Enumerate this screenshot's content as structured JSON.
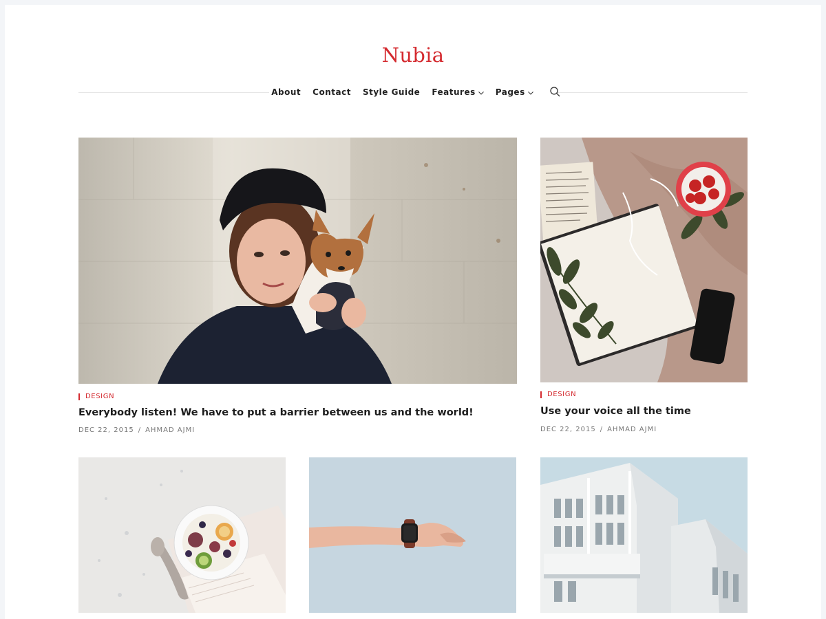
{
  "site": {
    "title": "Nubia"
  },
  "nav": {
    "items": [
      {
        "label": "About",
        "dropdown": false
      },
      {
        "label": "Contact",
        "dropdown": false
      },
      {
        "label": "Style Guide",
        "dropdown": false
      },
      {
        "label": "Features",
        "dropdown": true
      },
      {
        "label": "Pages",
        "dropdown": true
      }
    ],
    "search_icon": "search-icon"
  },
  "posts": [
    {
      "category": "DESIGN",
      "title": "Everybody listen! We have to put a barrier between us and the world!",
      "date": "DEC 22, 2015",
      "author": "AHMAD AJMI",
      "image": "woman-with-dog"
    },
    {
      "category": "DESIGN",
      "title": "Use your voice all the time",
      "date": "DEC 22, 2015",
      "author": "AHMAD AJMI",
      "image": "notebook-strawberries"
    },
    {
      "image": "fruit-bowl"
    },
    {
      "image": "wrist-watch"
    },
    {
      "image": "white-building"
    }
  ],
  "colors": {
    "accent": "#d42a2f",
    "background": "#f3f5f8"
  }
}
